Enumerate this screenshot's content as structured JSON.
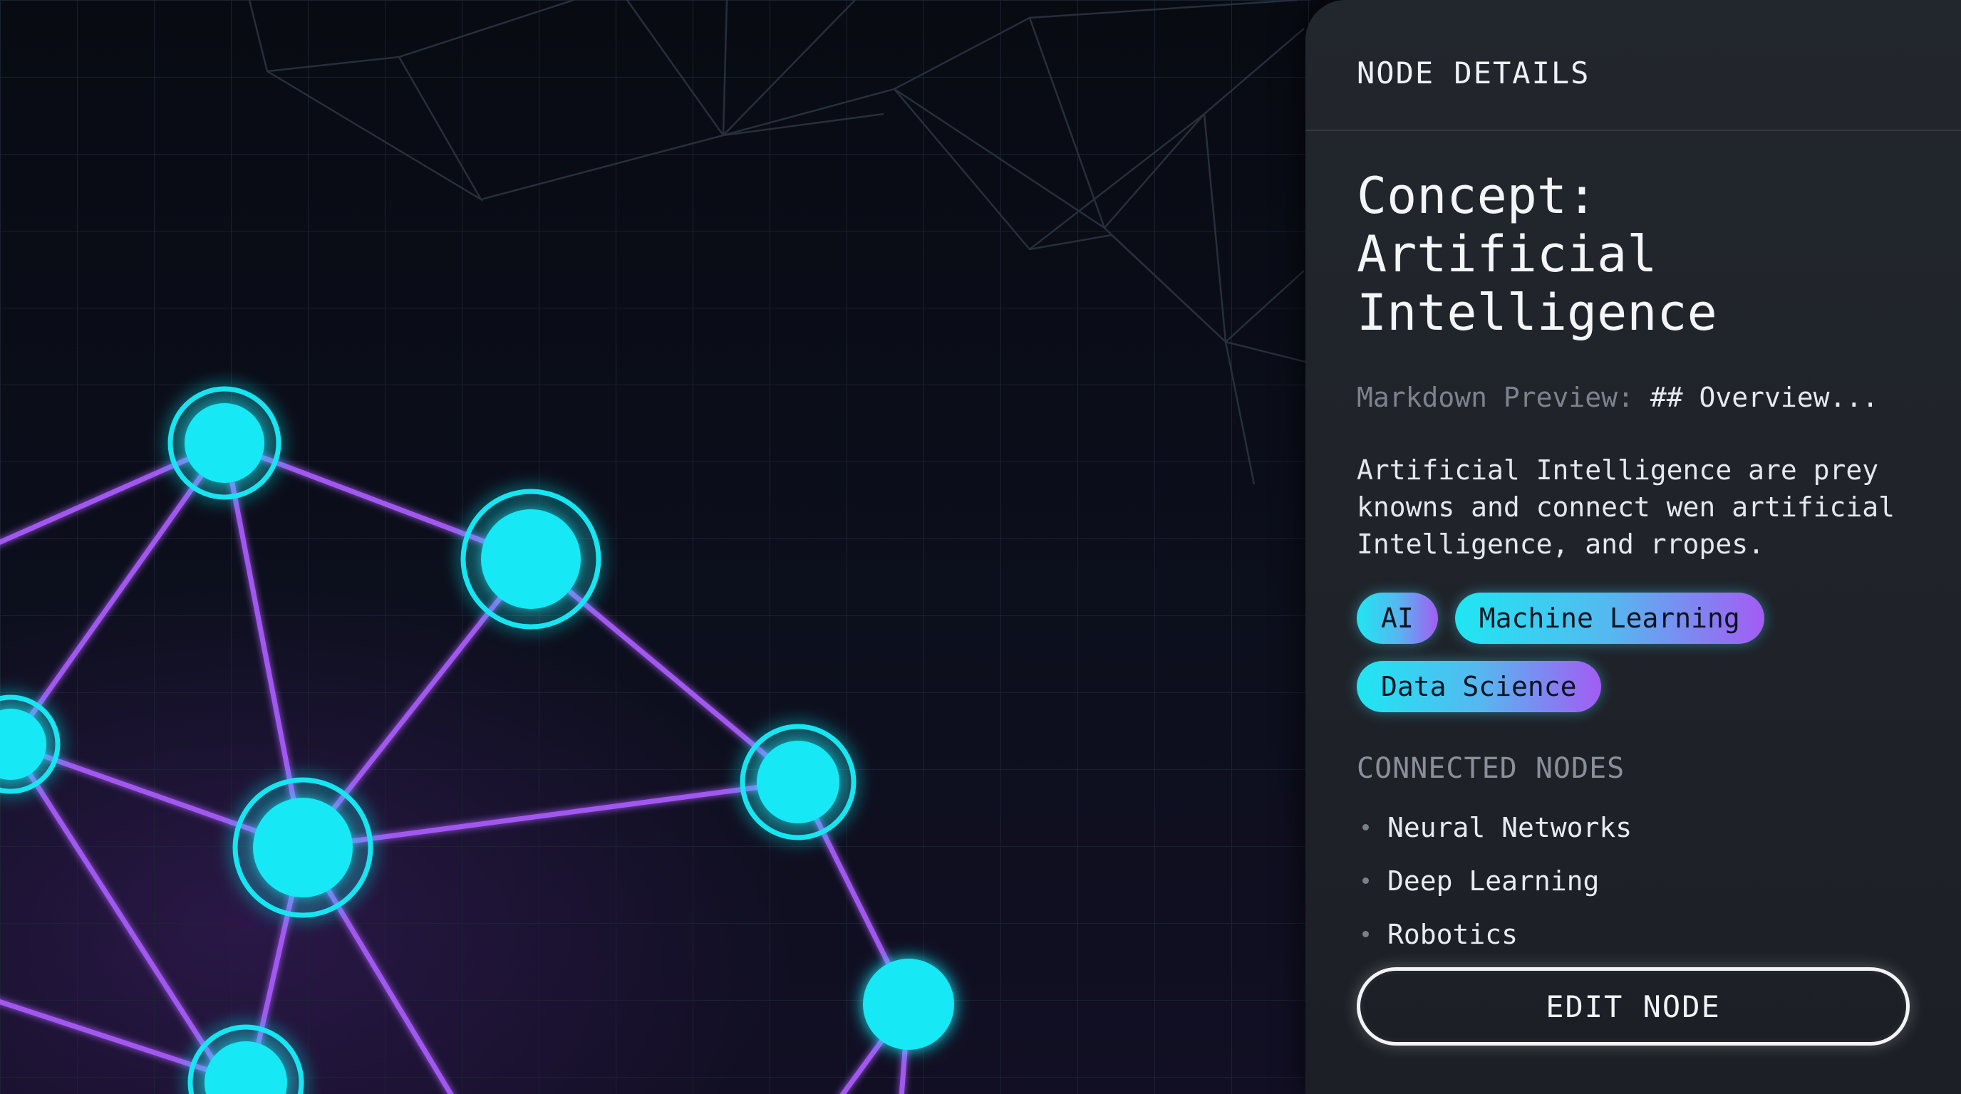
{
  "panel": {
    "header": "NODE DETAILS",
    "title": "Concept: Artificial Intelligence",
    "markdown_label": "Markdown Preview:",
    "markdown_value": "## Overview...",
    "description": "Artificial Intelligence are prey knowns and connect wen artificial Intelligence, and rropes.",
    "tags": [
      "AI",
      "Machine Learning",
      "Data Science"
    ],
    "connected_title": "CONNECTED NODES",
    "connected_nodes": [
      "Neural Networks",
      "Deep Learning",
      "Robotics"
    ],
    "edit_button": "EDIT NODE"
  },
  "colors": {
    "background": "#0b0e17",
    "panel": "#22262d",
    "node_fill": "#18e9f5",
    "edge": "#a258f0",
    "tag_gradient_start": "#1fe6f2",
    "tag_gradient_end": "#a35cf2"
  }
}
